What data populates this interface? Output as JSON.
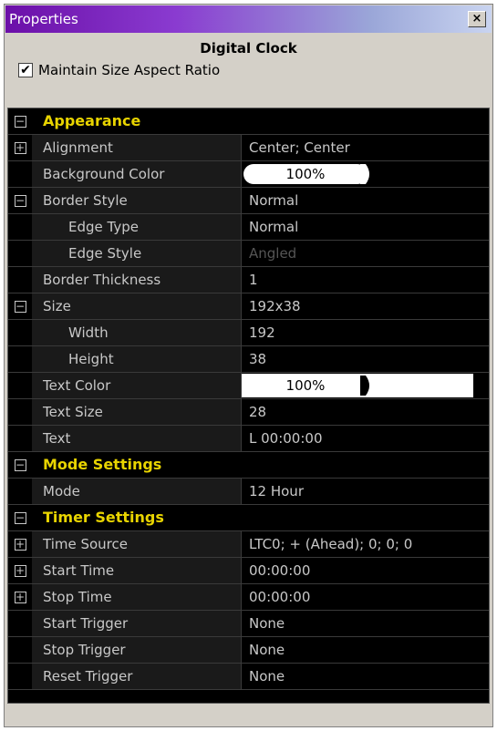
{
  "window": {
    "title": "Properties",
    "close_label": "×"
  },
  "header": {
    "object_name": "Digital Clock",
    "maintain_aspect": {
      "label": "Maintain Size Aspect Ratio",
      "checked": true,
      "mark": "✔"
    }
  },
  "rows": [
    {
      "type": "section",
      "label": "Appearance",
      "toggle": "−"
    },
    {
      "label": "Alignment",
      "value": "Center; Center",
      "toggle": "+"
    },
    {
      "label": "Background Color",
      "value": "100%",
      "color": "#000000",
      "kind": "color"
    },
    {
      "label": "Border Style",
      "value": "Normal",
      "toggle": "−"
    },
    {
      "label": "Edge Type",
      "value": "Normal",
      "indent": true
    },
    {
      "label": "Edge Style",
      "value": "Angled",
      "indent": true,
      "disabled": true
    },
    {
      "label": "Border Thickness",
      "value": "1"
    },
    {
      "label": "Size",
      "value": "192x38",
      "toggle": "−"
    },
    {
      "label": "Width",
      "value": "192",
      "indent": true
    },
    {
      "label": "Height",
      "value": "38",
      "indent": true
    },
    {
      "label": "Text Color",
      "value": "100%",
      "color": "#ffffff",
      "kind": "color"
    },
    {
      "label": "Text Size",
      "value": "28"
    },
    {
      "label": "Text",
      "value": "L 00:00:00"
    },
    {
      "type": "section",
      "label": "Mode Settings",
      "toggle": "−"
    },
    {
      "label": "Mode",
      "value": "12 Hour"
    },
    {
      "type": "section",
      "label": "Timer Settings",
      "toggle": "−"
    },
    {
      "label": "Time Source",
      "value": "LTC0; + (Ahead); 0; 0; 0",
      "toggle": "+"
    },
    {
      "label": "Start Time",
      "value": "00:00:00",
      "toggle": "+"
    },
    {
      "label": "Stop Time",
      "value": "00:00:00",
      "toggle": "+"
    },
    {
      "label": "Start Trigger",
      "value": "None"
    },
    {
      "label": "Stop Trigger",
      "value": "None"
    },
    {
      "label": "Reset Trigger",
      "value": "None"
    }
  ]
}
